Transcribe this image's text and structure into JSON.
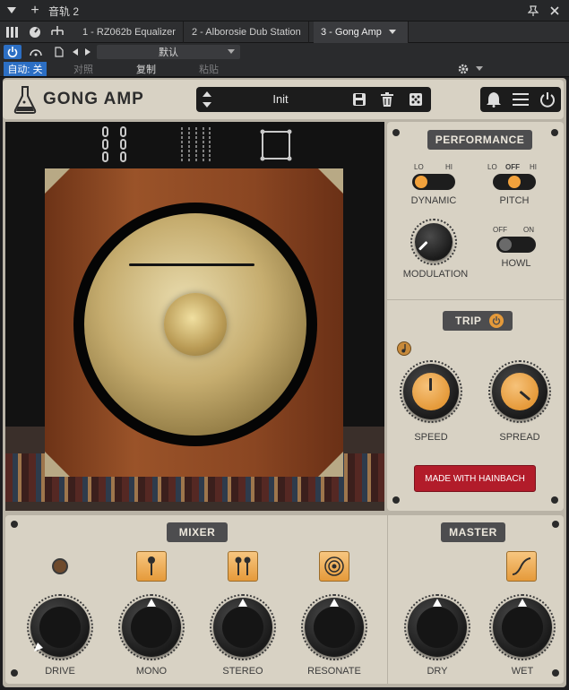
{
  "host": {
    "track_label": "音轨 2",
    "tabs": [
      {
        "label": "1 - RZ062b Equalizer"
      },
      {
        "label": "2 - Alborosie Dub Station"
      },
      {
        "label": "3 - Gong Amp"
      }
    ],
    "preset_default": "默认",
    "auto_label": "自动: 关",
    "compare_label": "对照",
    "copy_label": "复制",
    "paste_label": "粘贴"
  },
  "plugin": {
    "title": "GONG AMP",
    "preset_name": "Init",
    "performance": {
      "label": "PERFORMANCE",
      "dynamic": {
        "label": "DYNAMIC",
        "lo": "LO",
        "hi": "HI",
        "value": "LO"
      },
      "pitch": {
        "label": "PITCH",
        "lo": "LO",
        "off": "OFF",
        "hi": "HI",
        "value": "OFF"
      },
      "modulation": {
        "label": "MODULATION"
      },
      "howl": {
        "label": "HOWL",
        "off": "OFF",
        "on": "ON",
        "value": "OFF"
      }
    },
    "trip": {
      "label": "TRIP",
      "speed": {
        "label": "SPEED"
      },
      "spread": {
        "label": "SPREAD"
      }
    },
    "made_with": "MADE WITH HAINBACH",
    "mixer": {
      "label": "MIXER",
      "knobs": [
        {
          "label": "DRIVE"
        },
        {
          "label": "MONO"
        },
        {
          "label": "STEREO"
        },
        {
          "label": "RESONATE"
        }
      ]
    },
    "master": {
      "label": "MASTER",
      "knobs": [
        {
          "label": "DRY"
        },
        {
          "label": "WET"
        }
      ]
    }
  }
}
